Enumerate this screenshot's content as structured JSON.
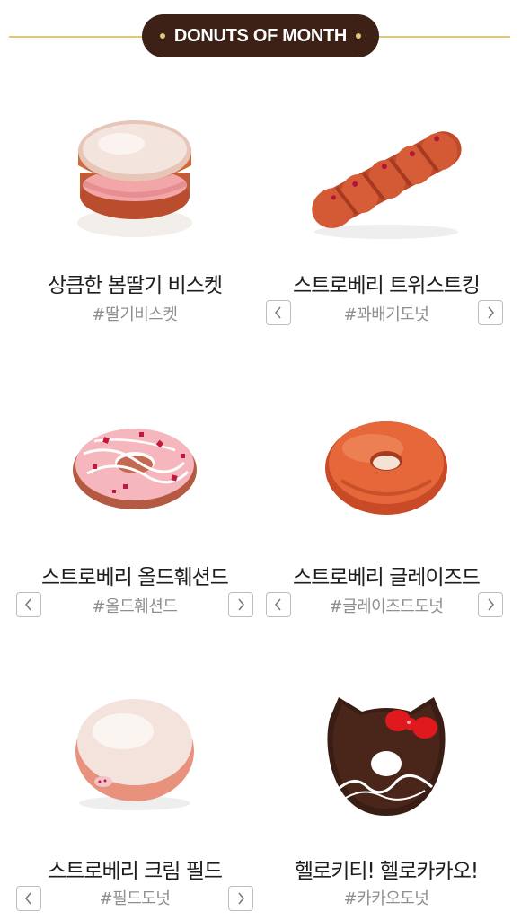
{
  "header": {
    "title": "DONUTS OF MONTH"
  },
  "products": [
    {
      "name": "상큼한 봄딸기 비스켓",
      "tag": "#딸기비스켓",
      "icon": "strawberry-biscuit-image"
    },
    {
      "name": "스트로베리 트위스트킹",
      "tag": "#꽈배기도넛",
      "icon": "strawberry-twist-image"
    },
    {
      "name": "스트로베리 올드훼션드",
      "tag": "#올드훼션드",
      "icon": "strawberry-old-fashioned-image"
    },
    {
      "name": "스트로베리 글레이즈드",
      "tag": "#글레이즈드도넛",
      "icon": "strawberry-glazed-image"
    },
    {
      "name": "스트로베리 크림 필드",
      "tag": "#필드도넛",
      "icon": "strawberry-cream-filled-image"
    },
    {
      "name": "헬로키티! 헬로카카오!",
      "tag": "#카카오도넛",
      "icon": "hello-kitty-cacao-image"
    }
  ]
}
